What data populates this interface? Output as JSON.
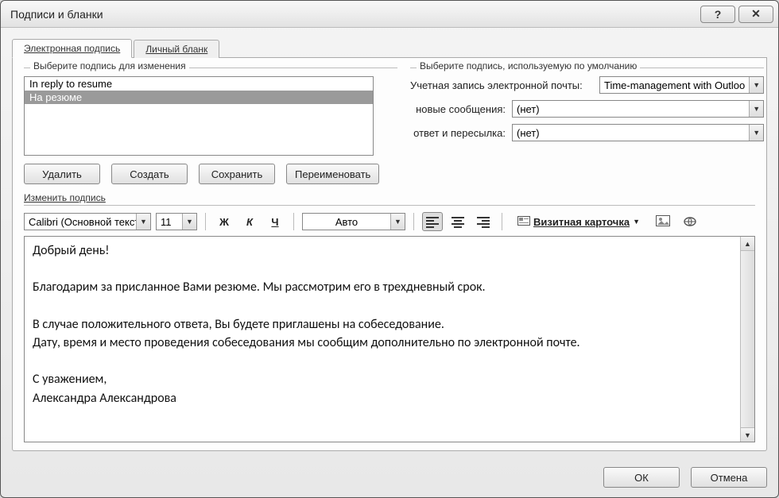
{
  "window": {
    "title": "Подписи и бланки"
  },
  "tabs": {
    "signature": "Электронная подпись",
    "stationery": "Личный бланк"
  },
  "select_group_label": "Выберите подпись для изменения",
  "signature_list": [
    {
      "label": "In reply to resume",
      "selected": false
    },
    {
      "label": "На резюме",
      "selected": true
    }
  ],
  "buttons": {
    "delete": "Удалить",
    "new": "Создать",
    "save": "Сохранить",
    "rename": "Переименовать",
    "ok": "ОК",
    "cancel": "Отмена"
  },
  "default_group_label": "Выберите подпись, используемую по умолчанию",
  "labels": {
    "account": "Учетная запись электронной почты:",
    "new_messages": "новые сообщения:",
    "replies": "ответ и пересылка:"
  },
  "defaults": {
    "account": "Time-management with Outloo",
    "new_messages": "(нет)",
    "replies": "(нет)"
  },
  "edit_label": "Изменить подпись",
  "toolbar": {
    "font": "Calibri (Основной текст",
    "size": "11",
    "bold": "Ж",
    "italic": "К",
    "underline": "Ч",
    "color_label": "Авто",
    "business_card": "Визитная карточка"
  },
  "editor_text": "Добрый день!\n\nБлагодарим за присланное Вами резюме. Мы рассмотрим его в трехдневный срок.\n\nВ случае положительного ответа, Вы будете приглашены на собеседование.\nДату, время и место проведения собеседования мы сообщим дополнительно по электронной почте.\n\nС уважением,\nАлександра Александрова"
}
